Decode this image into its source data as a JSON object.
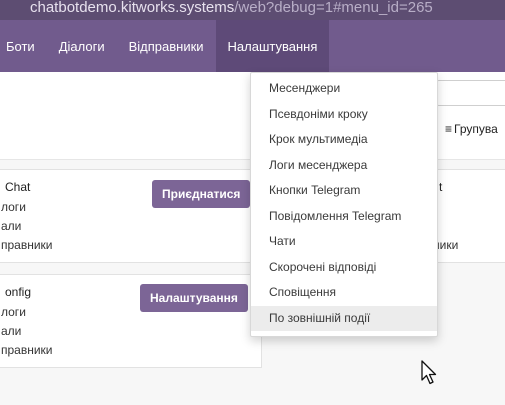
{
  "browser": {
    "url_host": "chatbotdemo.kitworks.systems",
    "url_rest": "/web?debug=1#menu_id=265"
  },
  "navbar": {
    "items": [
      {
        "label": "Боти"
      },
      {
        "label": "Діалоги"
      },
      {
        "label": "Відправники"
      },
      {
        "label": "Налаштування"
      }
    ]
  },
  "control_panel": {
    "group_by_label": "Групува"
  },
  "cards": [
    {
      "title": "Chat",
      "lines": [
        "логи",
        "али",
        "правники"
      ],
      "button_label": "Приєднатися"
    },
    {
      "title": "onfig",
      "lines": [
        "логи",
        "али",
        "правники"
      ],
      "button_label": "Налаштування"
    },
    {
      "title": "t",
      "lines": [
        "ники"
      ]
    }
  ],
  "settings_menu": {
    "items": [
      {
        "label": "Месенджери"
      },
      {
        "label": "Псевдоніми кроку"
      },
      {
        "label": "Крок мультимедіа"
      },
      {
        "label": "Логи месенджера"
      },
      {
        "label": "Кнопки Telegram"
      },
      {
        "label": "Повідомлення Telegram"
      },
      {
        "label": "Чати"
      },
      {
        "label": "Скорочені відповіді"
      },
      {
        "label": "Сповіщення"
      },
      {
        "label": "По зовнішній події"
      }
    ]
  },
  "colors": {
    "navbar": "#715b8d",
    "navbar_active": "#5e4a78",
    "button": "#7c6596"
  }
}
